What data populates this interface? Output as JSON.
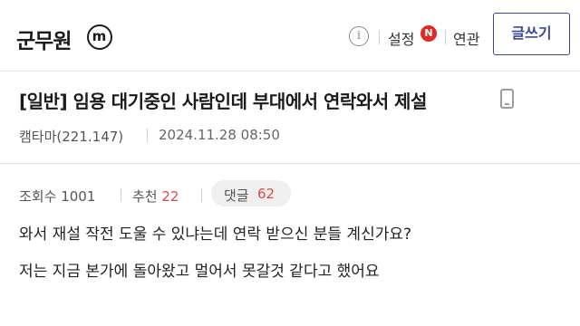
{
  "header": {
    "gallery_name": "군무원",
    "minor_badge": "m",
    "info_icon": "info-icon",
    "settings_label": "설정",
    "new_badge": "N",
    "related_label": "연관",
    "write_button_label": "글쓰기"
  },
  "post": {
    "title": "[일반] 임용 대기중인 사람인데 부대에서 연락와서 제설",
    "device_icon": "mobile-icon",
    "author": "캠타마(221.147)",
    "date": "2024.11.28 08:50",
    "views_label": "조회수",
    "views_count": "1001",
    "recommend_label": "추천",
    "recommend_count": "22",
    "comments_label": "댓글",
    "comments_count": "62",
    "body_lines": [
      "와서 재설 작전 도울 수 있냐는데 연락 받으신 분들 계신가요?",
      "저는 지금 본가에 돌아왔고 멀어서 못갈것 같다고 했어요"
    ]
  },
  "colors": {
    "accent_blue": "#3b4890",
    "highlight_red": "#e04848",
    "badge_red": "#e02a24"
  }
}
